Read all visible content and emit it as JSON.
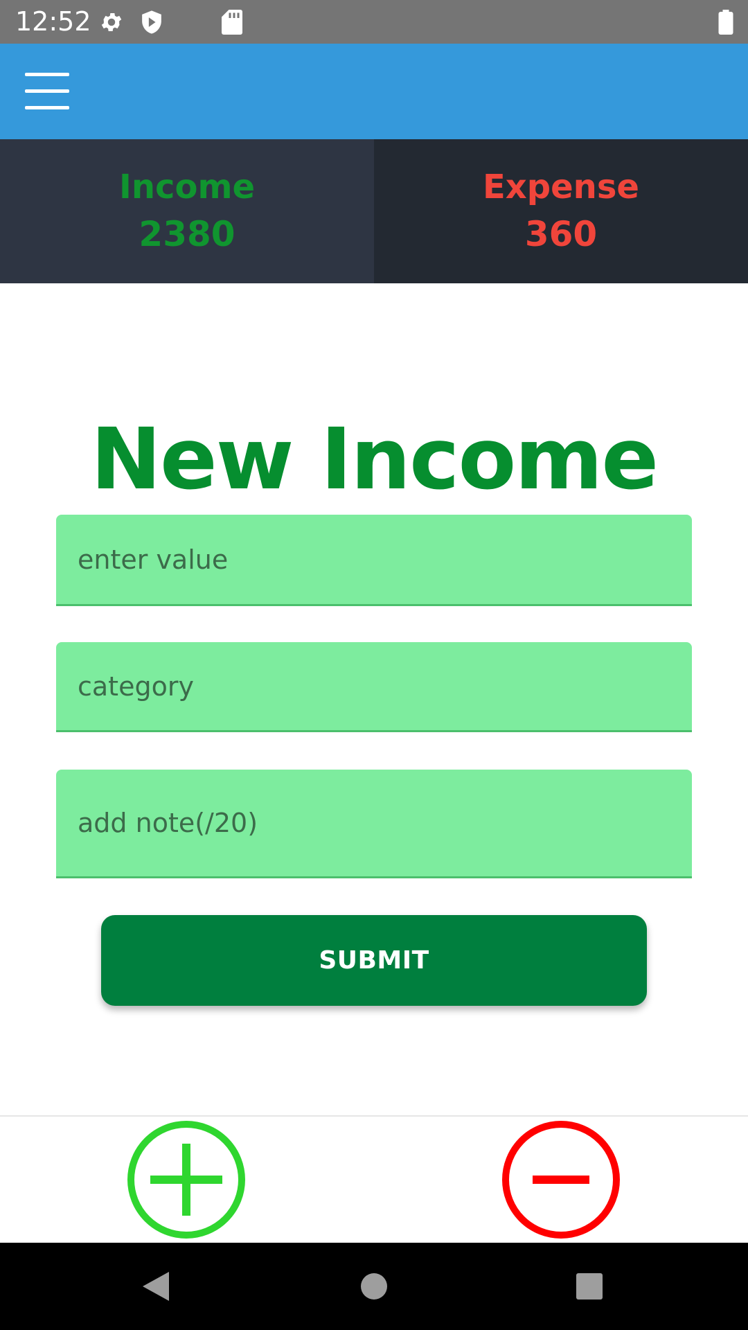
{
  "status_bar": {
    "time": "12:52",
    "icons": [
      "settings-gear-icon",
      "shield-icon",
      "sd-card-icon",
      "battery-icon"
    ]
  },
  "app_bar": {
    "menu_icon": "hamburger-menu-icon",
    "color": "#3599db"
  },
  "summary": {
    "income_label": "Income",
    "income_value": "2380",
    "expense_label": "Expense",
    "expense_value": "360",
    "income_color": "#10952f",
    "expense_color": "#f0453b"
  },
  "form": {
    "title": "New Income",
    "value_placeholder": "enter value",
    "category_placeholder": "category",
    "note_placeholder": "add note(/20)",
    "submit_label": "SUBMIT",
    "field_color": "#7dec9e",
    "button_color": "#007f3e"
  },
  "bottom_actions": {
    "add_icon": "plus-circle-icon",
    "remove_icon": "minus-circle-icon",
    "add_color": "#2fd62f",
    "remove_color": "#ff0000"
  },
  "system_nav": {
    "icons": [
      "back-icon",
      "home-icon",
      "recents-icon"
    ]
  }
}
